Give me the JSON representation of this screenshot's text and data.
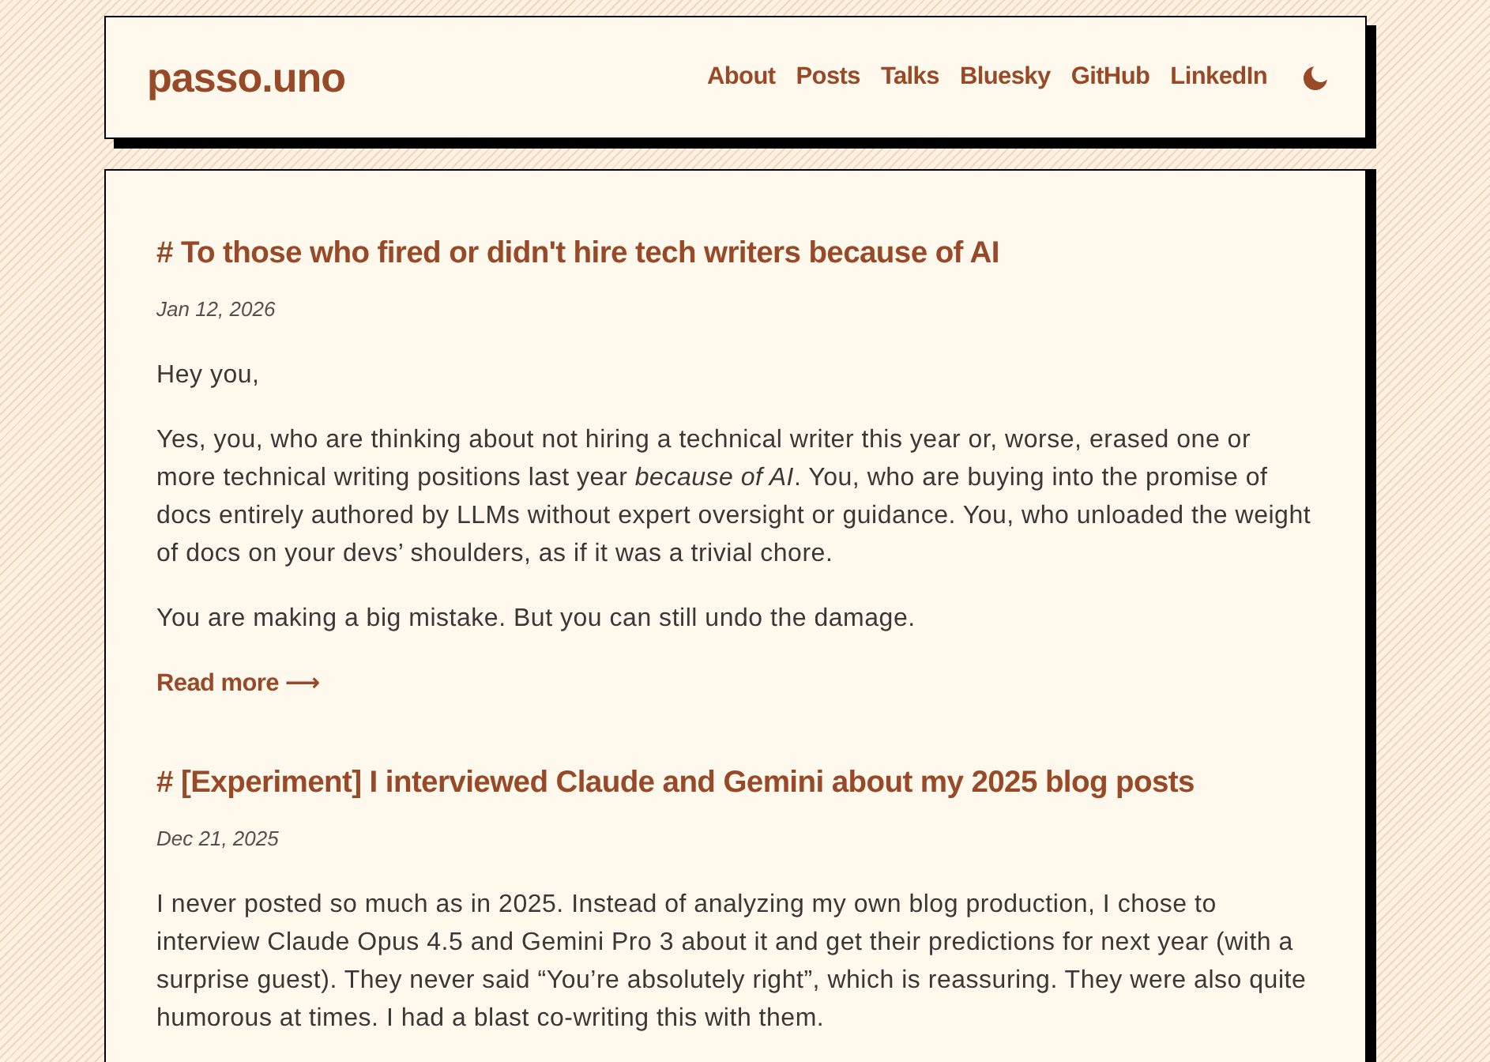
{
  "header": {
    "logo": "passo.uno",
    "nav": [
      {
        "label": "About"
      },
      {
        "label": "Posts"
      },
      {
        "label": "Talks"
      },
      {
        "label": "Bluesky"
      },
      {
        "label": "GitHub"
      },
      {
        "label": "LinkedIn"
      }
    ]
  },
  "posts": [
    {
      "title": "# To those who fired or didn't hire tech writers because of AI",
      "date": "Jan 12, 2026",
      "paragraphs": [
        "Hey you,",
        "Yes, you, who are thinking about not hiring a technical writer this year or, worse, erased one or more technical writing positions last year *because of AI*. You, who are buying into the promise of docs entirely authored by LLMs without expert oversight or guidance. You, who unloaded the weight of docs on your devs’ shoulders, as if it was a trivial chore.",
        "You are making a big mistake. But you can still undo the damage."
      ],
      "read_more": "Read more ⟶"
    },
    {
      "title": "# [Experiment] I interviewed Claude and Gemini about my 2025 blog posts",
      "date": "Dec 21, 2025",
      "paragraphs": [
        "I never posted so much as in 2025. Instead of analyzing my own blog production, I chose to interview Claude Opus 4.5 and Gemini Pro 3 about it and get their predictions for next year (with a surprise guest). They never said “You’re absolutely right”, which is reassuring. They were also quite humorous at times. I had a blast co-writing this with them."
      ]
    }
  ]
}
